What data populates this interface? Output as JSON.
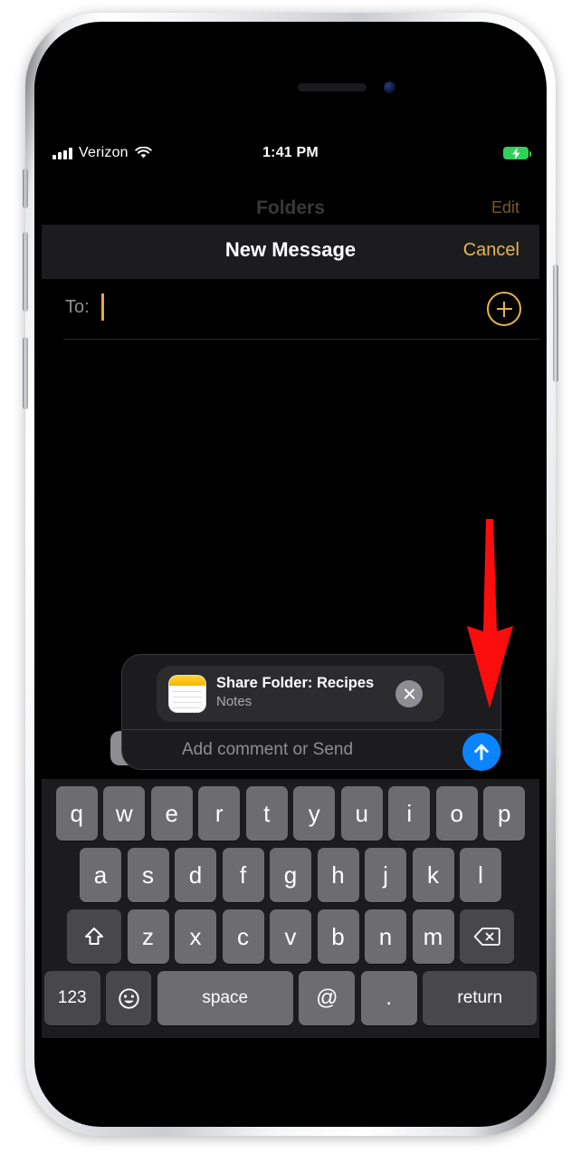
{
  "device": {
    "name": "iphone",
    "notch_speaker": "speaker-grille",
    "notch_camera": "front-camera"
  },
  "status_bar": {
    "carrier": "Verizon",
    "signal_icon": "cellular-bars-icon",
    "wifi_icon": "wifi-icon",
    "time": "1:41 PM",
    "battery_icon": "battery-charging-icon",
    "battery_color": "#30d158"
  },
  "background_screen": {
    "title": "Folders",
    "edit_label": "Edit"
  },
  "sheet": {
    "title": "New Message",
    "cancel_label": "Cancel",
    "accent_color": "#e6b352",
    "to": {
      "label": "To:",
      "value": "",
      "placeholder": "",
      "add_contact_icon": "plus-circle-icon"
    }
  },
  "share_panel": {
    "attachment": {
      "app_icon": "notes-app-icon",
      "title": "Share Folder: Recipes",
      "subtitle": "Notes",
      "remove_icon": "close-circle-icon"
    },
    "comment_placeholder": "Add comment or Send",
    "comment_value": "",
    "send_icon": "arrow-up-circle-icon",
    "send_color": "#0a84ff",
    "expand_icon": "chevron-right-icon"
  },
  "keyboard": {
    "row1": [
      "q",
      "w",
      "e",
      "r",
      "t",
      "y",
      "u",
      "i",
      "o",
      "p"
    ],
    "row2": [
      "a",
      "s",
      "d",
      "f",
      "g",
      "h",
      "j",
      "k",
      "l"
    ],
    "row3": [
      "z",
      "x",
      "c",
      "v",
      "b",
      "n",
      "m"
    ],
    "shift_icon": "shift-icon",
    "backspace_icon": "backspace-icon",
    "numbers_label": "123",
    "emoji_icon": "emoji-icon",
    "space_label": "space",
    "at_label": "@",
    "period_label": ".",
    "return_label": "return"
  },
  "annotation": {
    "arrow_icon": "red-down-arrow",
    "arrow_color": "#fc0d0d",
    "points_at": "send-button"
  }
}
